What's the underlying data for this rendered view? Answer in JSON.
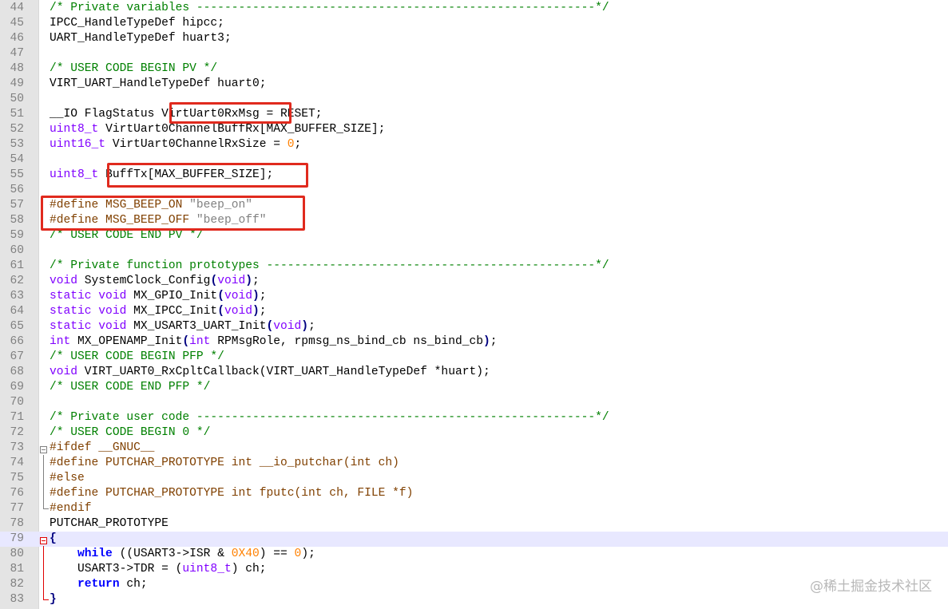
{
  "editor": {
    "lines": [
      {
        "num": "44",
        "parts": [
          [
            "cm",
            "/* Private variables ---------------------------------------------------------*/"
          ]
        ]
      },
      {
        "num": "45",
        "parts": [
          [
            "tx",
            "IPCC_HandleTypeDef hipcc;"
          ]
        ]
      },
      {
        "num": "46",
        "parts": [
          [
            "tx",
            "UART_HandleTypeDef huart3;"
          ]
        ]
      },
      {
        "num": "47",
        "parts": []
      },
      {
        "num": "48",
        "parts": [
          [
            "cm",
            "/* USER CODE BEGIN PV */"
          ]
        ]
      },
      {
        "num": "49",
        "parts": [
          [
            "tx",
            "VIRT_UART_HandleTypeDef huart0;"
          ]
        ]
      },
      {
        "num": "50",
        "parts": []
      },
      {
        "num": "51",
        "parts": [
          [
            "tx",
            "__IO FlagStatus VirtUart0RxMsg = RESET;"
          ]
        ]
      },
      {
        "num": "52",
        "parts": [
          [
            "kw",
            "uint8_t"
          ],
          [
            "tx",
            " VirtUart0ChannelBuffRx[MAX_BUFFER_SIZE];"
          ]
        ]
      },
      {
        "num": "53",
        "parts": [
          [
            "kw",
            "uint16_t"
          ],
          [
            "tx",
            " VirtUart0ChannelRxSize = "
          ],
          [
            "num",
            "0"
          ],
          [
            "tx",
            ";"
          ]
        ]
      },
      {
        "num": "54",
        "parts": []
      },
      {
        "num": "55",
        "parts": [
          [
            "kw",
            "uint8_t"
          ],
          [
            "tx",
            " BuffTx[MAX_BUFFER_SIZE];"
          ]
        ]
      },
      {
        "num": "56",
        "parts": []
      },
      {
        "num": "57",
        "parts": [
          [
            "pp",
            "#define MSG_BEEP_ON "
          ],
          [
            "str",
            "\"beep_on\""
          ]
        ]
      },
      {
        "num": "58",
        "parts": [
          [
            "pp",
            "#define MSG_BEEP_OFF "
          ],
          [
            "str",
            "\"beep_off\""
          ]
        ]
      },
      {
        "num": "59",
        "parts": [
          [
            "cm",
            "/* USER CODE END PV */"
          ]
        ]
      },
      {
        "num": "60",
        "parts": []
      },
      {
        "num": "61",
        "parts": [
          [
            "cm",
            "/* Private function prototypes -----------------------------------------------*/"
          ]
        ]
      },
      {
        "num": "62",
        "parts": [
          [
            "kw",
            "void"
          ],
          [
            "tx",
            " SystemClock_Config"
          ],
          [
            "op",
            "("
          ],
          [
            "kw",
            "void"
          ],
          [
            "op",
            ")"
          ],
          [
            "tx",
            ";"
          ]
        ]
      },
      {
        "num": "63",
        "parts": [
          [
            "kw",
            "static void"
          ],
          [
            "tx",
            " MX_GPIO_Init"
          ],
          [
            "op",
            "("
          ],
          [
            "kw",
            "void"
          ],
          [
            "op",
            ")"
          ],
          [
            "tx",
            ";"
          ]
        ]
      },
      {
        "num": "64",
        "parts": [
          [
            "kw",
            "static void"
          ],
          [
            "tx",
            " MX_IPCC_Init"
          ],
          [
            "op",
            "("
          ],
          [
            "kw",
            "void"
          ],
          [
            "op",
            ")"
          ],
          [
            "tx",
            ";"
          ]
        ]
      },
      {
        "num": "65",
        "parts": [
          [
            "kw",
            "static void"
          ],
          [
            "tx",
            " MX_USART3_UART_Init"
          ],
          [
            "op",
            "("
          ],
          [
            "kw",
            "void"
          ],
          [
            "op",
            ")"
          ],
          [
            "tx",
            ";"
          ]
        ]
      },
      {
        "num": "66",
        "parts": [
          [
            "kw",
            "int"
          ],
          [
            "tx",
            " MX_OPENAMP_Init"
          ],
          [
            "op",
            "("
          ],
          [
            "kw",
            "int"
          ],
          [
            "tx",
            " RPMsgRole, rpmsg_ns_bind_cb ns_bind_cb"
          ],
          [
            "op",
            ")"
          ],
          [
            "tx",
            ";"
          ]
        ]
      },
      {
        "num": "67",
        "parts": [
          [
            "cm",
            "/* USER CODE BEGIN PFP */"
          ]
        ]
      },
      {
        "num": "68",
        "parts": [
          [
            "kw",
            "void"
          ],
          [
            "tx",
            " VIRT_UART0_RxCpltCallback(VIRT_UART_HandleTypeDef *huart);"
          ]
        ]
      },
      {
        "num": "69",
        "parts": [
          [
            "cm",
            "/* USER CODE END PFP */"
          ]
        ]
      },
      {
        "num": "70",
        "parts": []
      },
      {
        "num": "71",
        "parts": [
          [
            "cm",
            "/* Private user code ---------------------------------------------------------*/"
          ]
        ]
      },
      {
        "num": "72",
        "parts": [
          [
            "cm",
            "/* USER CODE BEGIN 0 */"
          ]
        ]
      },
      {
        "num": "73",
        "parts": [
          [
            "pp",
            "#ifdef __GNUC__"
          ]
        ]
      },
      {
        "num": "74",
        "parts": [
          [
            "pp",
            "#define PUTCHAR_PROTOTYPE int __io_putchar(int ch)"
          ]
        ]
      },
      {
        "num": "75",
        "parts": [
          [
            "pp",
            "#else"
          ]
        ]
      },
      {
        "num": "76",
        "parts": [
          [
            "pp",
            "#define PUTCHAR_PROTOTYPE int fputc(int ch, FILE *f)"
          ]
        ]
      },
      {
        "num": "77",
        "parts": [
          [
            "pp",
            "#endif"
          ]
        ]
      },
      {
        "num": "78",
        "parts": [
          [
            "tx",
            "PUTCHAR_PROTOTYPE"
          ]
        ]
      },
      {
        "num": "79",
        "parts": [
          [
            "op",
            "{"
          ]
        ]
      },
      {
        "num": "80",
        "parts": [
          [
            "tx",
            "    "
          ],
          [
            "kb",
            "while"
          ],
          [
            "tx",
            " (("
          ],
          [
            "tx",
            "USART3->ISR & "
          ],
          [
            "num",
            "0X40"
          ],
          [
            "tx",
            ") == "
          ],
          [
            "num",
            "0"
          ],
          [
            "tx",
            ");"
          ]
        ]
      },
      {
        "num": "81",
        "parts": [
          [
            "tx",
            "    USART3->TDR = ("
          ],
          [
            "kw",
            "uint8_t"
          ],
          [
            "tx",
            ") ch;"
          ]
        ]
      },
      {
        "num": "82",
        "parts": [
          [
            "tx",
            "    "
          ],
          [
            "kb",
            "return"
          ],
          [
            "tx",
            " ch;"
          ]
        ]
      },
      {
        "num": "83",
        "parts": [
          [
            "op",
            "}"
          ]
        ]
      }
    ],
    "current_line": "79"
  },
  "watermark": "@稀土掘金技术社区"
}
